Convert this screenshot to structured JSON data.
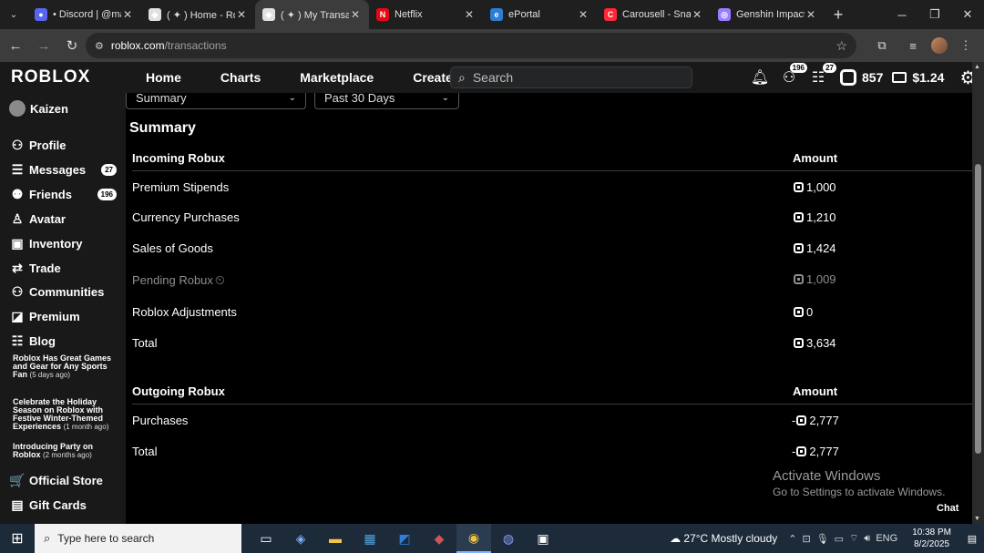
{
  "browser": {
    "tabs": [
      {
        "label": "• Discord | @ma",
        "fav_color": "#5865f2",
        "fav_glyph": "●",
        "active": false
      },
      {
        "label": "( ✦ ) Home - Ro",
        "fav_color": "#e0e0e0",
        "fav_glyph": "◆",
        "active": false
      },
      {
        "label": "( ✦ ) My Transac",
        "fav_color": "#e0e0e0",
        "fav_glyph": "◆",
        "active": true
      },
      {
        "label": "Netflix",
        "fav_color": "#e50914",
        "fav_glyph": "N",
        "active": false
      },
      {
        "label": "ePortal",
        "fav_color": "#2d7dd2",
        "fav_glyph": "e",
        "active": false
      },
      {
        "label": "Carousell - Snap",
        "fav_color": "#ff2636",
        "fav_glyph": "C",
        "active": false
      },
      {
        "label": "Genshin Impact",
        "fav_color": "#9a7cff",
        "fav_glyph": "◎",
        "active": false
      }
    ],
    "new_tab_glyph": "+",
    "url_host": "roblox.com",
    "url_path": "/transactions"
  },
  "header": {
    "logo": "ROBLOX",
    "nav": [
      "Home",
      "Charts",
      "Marketplace",
      "Create"
    ],
    "search_placeholder": "Search",
    "friends_badge": "196",
    "messages_badge": "27",
    "robux_balance": "857",
    "cash_balance": "$1.24"
  },
  "sidebar": {
    "username": "Kaizen",
    "items": [
      {
        "label": "Profile",
        "icon": "person-icon",
        "glyph": "⚇"
      },
      {
        "label": "Messages",
        "icon": "messages-icon",
        "glyph": "☰",
        "badge": "27"
      },
      {
        "label": "Friends",
        "icon": "friends-icon",
        "glyph": "⚉",
        "badge": "196"
      },
      {
        "label": "Avatar",
        "icon": "avatar-icon",
        "glyph": "♙"
      },
      {
        "label": "Inventory",
        "icon": "inventory-icon",
        "glyph": "▣"
      },
      {
        "label": "Trade",
        "icon": "trade-icon",
        "glyph": "⇄"
      },
      {
        "label": "Communities",
        "icon": "communities-icon",
        "glyph": "⚇"
      },
      {
        "label": "Premium",
        "icon": "premium-icon",
        "glyph": "◪"
      },
      {
        "label": "Blog",
        "icon": "blog-icon",
        "glyph": "☷"
      }
    ],
    "blog_posts": [
      {
        "title": "Roblox Has Great Games and Gear for Any Sports Fan",
        "when": "(5 days ago)"
      },
      {
        "title": "Celebrate the Holiday Season on Roblox with Festive Winter-Themed Experiences",
        "when": "(1 month ago)"
      },
      {
        "title": "Introducing Party on Roblox",
        "when": "(2 months ago)"
      }
    ],
    "bottom_items": [
      {
        "label": "Official Store",
        "icon": "store-icon",
        "glyph": "🛒"
      },
      {
        "label": "Gift Cards",
        "icon": "gift-card-icon",
        "glyph": "▤"
      }
    ]
  },
  "main": {
    "dropdown_type": "Summary",
    "dropdown_period": "Past 30 Days",
    "section_title": "Summary",
    "incoming": {
      "header": "Incoming Robux",
      "amount_header": "Amount",
      "rows": [
        {
          "label": "Premium Stipends",
          "amount": "1,000",
          "pending": false
        },
        {
          "label": "Currency Purchases",
          "amount": "1,210",
          "pending": false
        },
        {
          "label": "Sales of Goods",
          "amount": "1,424",
          "pending": false
        },
        {
          "label": "Pending Robux",
          "amount": "1,009",
          "pending": true
        },
        {
          "label": "Roblox Adjustments",
          "amount": "0",
          "pending": false
        },
        {
          "label": "Total",
          "amount": "3,634",
          "pending": false
        }
      ]
    },
    "outgoing": {
      "header": "Outgoing Robux",
      "amount_header": "Amount",
      "rows": [
        {
          "label": "Purchases",
          "amount": "2,777",
          "prefix": "-"
        },
        {
          "label": "Total",
          "amount": "2,777",
          "prefix": "-"
        }
      ]
    },
    "activate_title": "Activate Windows",
    "activate_sub": "Go to Settings to activate Windows.",
    "chat_label": "Chat"
  },
  "taskbar": {
    "search_placeholder": "Type here to search",
    "weather": "27°C  Mostly cloudy",
    "lang": "ENG",
    "time": "10:38 PM",
    "date": "8/2/2025"
  }
}
